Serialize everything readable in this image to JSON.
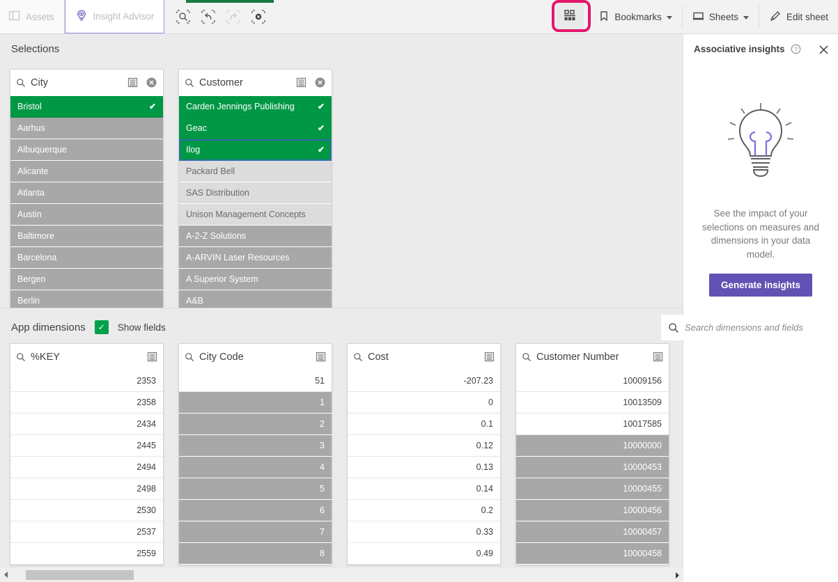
{
  "toolbar": {
    "assets_label": "Assets",
    "assets_icon": "panel-icon",
    "advisor_label": "Insight Advisor",
    "advisor_icon": "insight-bulb-eye-icon",
    "icon_buttons": [
      {
        "name": "selections-search-icon",
        "title": "Search selections",
        "disabled": false
      },
      {
        "name": "step-back-icon",
        "title": "Step back",
        "disabled": false
      },
      {
        "name": "step-forward-icon",
        "title": "Step forward",
        "disabled": true
      },
      {
        "name": "clear-all-selections-icon",
        "title": "Clear all selections",
        "disabled": false
      }
    ],
    "selections_tool_icon": "selections-tool-icon",
    "selections_tool_highlight_color": "#e3176b",
    "bookmarks_label": "Bookmarks",
    "bookmarks_icon": "bookmark-icon",
    "sheets_label": "Sheets",
    "sheets_icon": "sheet-icon",
    "edit_sheet_label": "Edit sheet",
    "edit_sheet_icon": "pencil-icon",
    "active_tab_color": "#177a3e"
  },
  "colors": {
    "selected": "#009845",
    "excluded": "#a8a8a8",
    "alternative": "#dcdcdc",
    "optional": "#ffffff",
    "accent_purple": "#6152b3",
    "highlight_pink": "#e3176b"
  },
  "selections": {
    "title": "Selections",
    "cards": [
      {
        "field": "City",
        "search_icon": "search-icon",
        "list_icon": "list-view-icon",
        "clear_icon": "clear-selection-icon",
        "rows": [
          {
            "label": "Bristol",
            "state": "selected",
            "tick": "✔"
          },
          {
            "label": "Aarhus",
            "state": "excluded",
            "tick": ""
          },
          {
            "label": "Albuquerque",
            "state": "excluded",
            "tick": ""
          },
          {
            "label": "Alicante",
            "state": "excluded",
            "tick": ""
          },
          {
            "label": "Atlanta",
            "state": "excluded",
            "tick": ""
          },
          {
            "label": "Austin",
            "state": "excluded",
            "tick": ""
          },
          {
            "label": "Baltimore",
            "state": "excluded",
            "tick": ""
          },
          {
            "label": "Barcelona",
            "state": "excluded",
            "tick": ""
          },
          {
            "label": "Bergen",
            "state": "excluded",
            "tick": ""
          },
          {
            "label": "Berlin",
            "state": "excluded",
            "tick": ""
          }
        ]
      },
      {
        "field": "Customer",
        "search_icon": "search-icon",
        "list_icon": "list-view-icon",
        "clear_icon": "clear-selection-icon",
        "rows": [
          {
            "label": "Carden Jennings Publishing",
            "state": "selected",
            "tick": "✔"
          },
          {
            "label": "Geac",
            "state": "selected",
            "tick": "✔"
          },
          {
            "label": "Ilog",
            "state": "selected",
            "tick": "✔",
            "focused": true
          },
          {
            "label": "Packard Bell",
            "state": "alternative",
            "tick": ""
          },
          {
            "label": "SAS Distribution",
            "state": "alternative",
            "tick": ""
          },
          {
            "label": "Unison Management Concepts",
            "state": "alternative",
            "tick": ""
          },
          {
            "label": "A-2-Z Solutions",
            "state": "excluded",
            "tick": ""
          },
          {
            "label": "A-ARVIN Laser Resources",
            "state": "excluded",
            "tick": ""
          },
          {
            "label": "A Superior System",
            "state": "excluded",
            "tick": ""
          },
          {
            "label": "A&B",
            "state": "excluded",
            "tick": ""
          }
        ]
      }
    ]
  },
  "app_dimensions": {
    "title": "App dimensions",
    "show_fields_label": "Show fields",
    "show_fields_checked": true,
    "search": {
      "placeholder": "Search dimensions and fields",
      "value": "",
      "icon": "search-icon"
    },
    "cards": [
      {
        "field": "%KEY",
        "search_icon": "search-icon",
        "list_icon": "list-view-icon",
        "rows": [
          {
            "label": "2353",
            "state": "optional"
          },
          {
            "label": "2358",
            "state": "optional"
          },
          {
            "label": "2434",
            "state": "optional"
          },
          {
            "label": "2445",
            "state": "optional"
          },
          {
            "label": "2494",
            "state": "optional"
          },
          {
            "label": "2498",
            "state": "optional"
          },
          {
            "label": "2530",
            "state": "optional"
          },
          {
            "label": "2537",
            "state": "optional"
          },
          {
            "label": "2559",
            "state": "optional"
          }
        ]
      },
      {
        "field": "City Code",
        "search_icon": "search-icon",
        "list_icon": "list-view-icon",
        "rows": [
          {
            "label": "51",
            "state": "optional"
          },
          {
            "label": "1",
            "state": "excluded"
          },
          {
            "label": "2",
            "state": "excluded"
          },
          {
            "label": "3",
            "state": "excluded"
          },
          {
            "label": "4",
            "state": "excluded"
          },
          {
            "label": "5",
            "state": "excluded"
          },
          {
            "label": "6",
            "state": "excluded"
          },
          {
            "label": "7",
            "state": "excluded"
          },
          {
            "label": "8",
            "state": "excluded"
          }
        ]
      },
      {
        "field": "Cost",
        "search_icon": "search-icon",
        "list_icon": "list-view-icon",
        "rows": [
          {
            "label": "-207.23",
            "state": "optional"
          },
          {
            "label": "0",
            "state": "optional"
          },
          {
            "label": "0.1",
            "state": "optional"
          },
          {
            "label": "0.12",
            "state": "optional"
          },
          {
            "label": "0.13",
            "state": "optional"
          },
          {
            "label": "0.14",
            "state": "optional"
          },
          {
            "label": "0.2",
            "state": "optional"
          },
          {
            "label": "0.33",
            "state": "optional"
          },
          {
            "label": "0.49",
            "state": "optional"
          }
        ]
      },
      {
        "field": "Customer Number",
        "search_icon": "search-icon",
        "list_icon": "list-view-icon",
        "rows": [
          {
            "label": "10009156",
            "state": "optional"
          },
          {
            "label": "10013509",
            "state": "optional"
          },
          {
            "label": "10017585",
            "state": "optional"
          },
          {
            "label": "10000000",
            "state": "excluded"
          },
          {
            "label": "10000453",
            "state": "excluded"
          },
          {
            "label": "10000455",
            "state": "excluded"
          },
          {
            "label": "10000456",
            "state": "excluded"
          },
          {
            "label": "10000457",
            "state": "excluded"
          },
          {
            "label": "10000458",
            "state": "excluded"
          }
        ]
      }
    ]
  },
  "associative_insights": {
    "title": "Associative insights",
    "help_icon": "help-circle-icon",
    "close_icon": "close-icon",
    "illustration_icon": "lightbulb-icon",
    "body_text": "See the impact of your selections on measures and dimensions in your data model.",
    "button_label": "Generate insights"
  },
  "scrollbar": {
    "left_arrow_icon": "chevron-left-icon",
    "right_arrow_icon": "chevron-right-icon"
  }
}
